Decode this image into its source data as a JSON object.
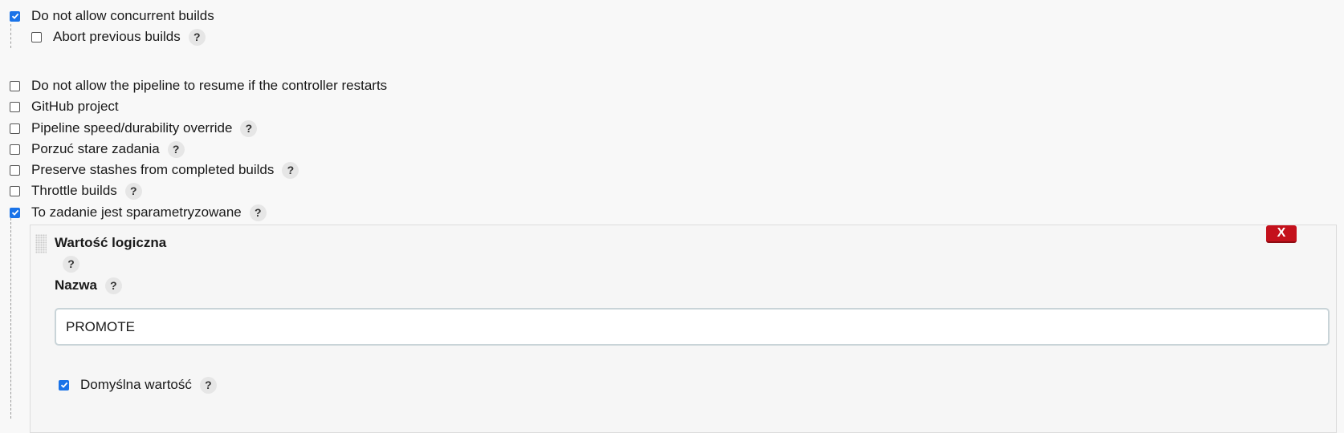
{
  "options": {
    "concurrent": {
      "label": "Do not allow concurrent builds",
      "checked": true
    },
    "abort_previous": {
      "label": "Abort previous builds",
      "checked": false,
      "help": "?"
    },
    "no_resume": {
      "label": "Do not allow the pipeline to resume if the controller restarts",
      "checked": false
    },
    "github_project": {
      "label": "GitHub project",
      "checked": false
    },
    "speed_override": {
      "label": "Pipeline speed/durability override",
      "checked": false,
      "help": "?"
    },
    "discard_old": {
      "label": "Porzuć stare zadania",
      "checked": false,
      "help": "?"
    },
    "preserve_stashes": {
      "label": "Preserve stashes from completed builds",
      "checked": false,
      "help": "?"
    },
    "throttle": {
      "label": "Throttle builds",
      "checked": false,
      "help": "?"
    },
    "parameterized": {
      "label": "To zadanie jest sparametryzowane",
      "checked": true,
      "help": "?"
    }
  },
  "parameter": {
    "title": "Wartość logiczna",
    "title_help": "?",
    "delete_label": "X",
    "name_label": "Nazwa",
    "name_help": "?",
    "name_value": "PROMOTE",
    "default_label": "Domyślna wartość",
    "default_checked": true,
    "default_help": "?"
  },
  "colors": {
    "checkbox_checked": "#1a73e8",
    "delete_button": "#c4111c"
  }
}
